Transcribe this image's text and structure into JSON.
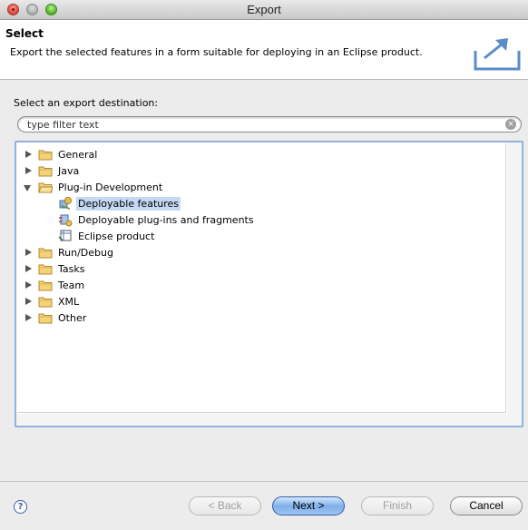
{
  "window": {
    "title": "Export"
  },
  "banner": {
    "title": "Select",
    "description": "Export the selected features in a form suitable for deploying in an Eclipse product.",
    "icon": "export-wizard-icon"
  },
  "destination_label": "Select an export destination:",
  "filter": {
    "placeholder": "type filter text",
    "value": "type filter text"
  },
  "tree": {
    "items": [
      {
        "label": "General",
        "state": "collapsed"
      },
      {
        "label": "Java",
        "state": "collapsed"
      },
      {
        "label": "Plug-in Development",
        "state": "expanded",
        "children": [
          {
            "label": "Deployable features",
            "icon": "feature-icon",
            "selected": true
          },
          {
            "label": "Deployable plug-ins and fragments",
            "icon": "plugin-icon"
          },
          {
            "label": "Eclipse product",
            "icon": "product-icon"
          }
        ]
      },
      {
        "label": "Run/Debug",
        "state": "collapsed"
      },
      {
        "label": "Tasks",
        "state": "collapsed"
      },
      {
        "label": "Team",
        "state": "collapsed"
      },
      {
        "label": "XML",
        "state": "collapsed"
      },
      {
        "label": "Other",
        "state": "collapsed"
      }
    ]
  },
  "buttons": {
    "help": "?",
    "back": "< Back",
    "next": "Next >",
    "finish": "Finish",
    "cancel": "Cancel"
  }
}
